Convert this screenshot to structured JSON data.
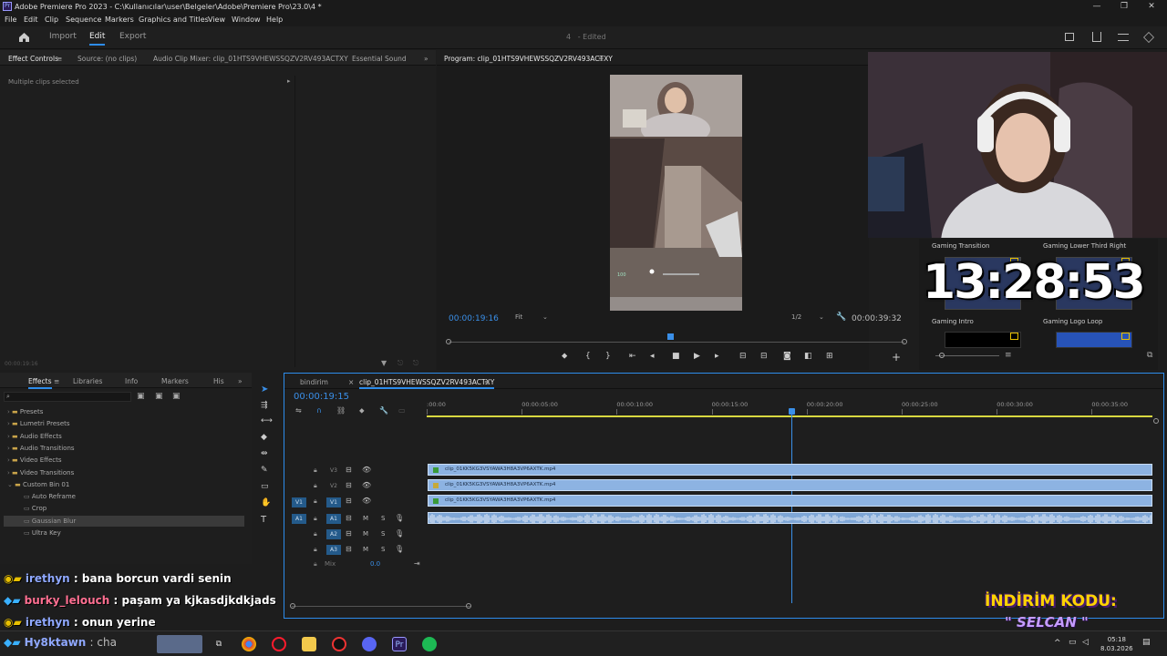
{
  "window": {
    "title": "Adobe Premiere Pro 2023 - C:\\Kullanıcılar\\user\\Belgeler\\Adobe\\Premiere Pro\\23.0\\4 *",
    "app_icon": "Pr"
  },
  "menu": [
    "File",
    "Edit",
    "Clip",
    "Sequence",
    "Markers",
    "Graphics and Titles",
    "View",
    "Window",
    "Help"
  ],
  "workspace": {
    "tabs": [
      "Import",
      "Edit",
      "Export"
    ],
    "active_tab": "Edit",
    "project": "4",
    "project_status": "- Edited"
  },
  "source_panel": {
    "tabs": [
      "Effect Controls",
      "Source: (no clips)",
      "Audio Clip Mixer: clip_01HTS9VHEWSSQZV2RV493ACTXY",
      "Essential Sound"
    ],
    "message": "Multiple clips selected",
    "timecode": "00:00:19:16"
  },
  "program_monitor": {
    "tab": "Program: clip_01HTS9VHEWSSQZV2RV493ACTXY",
    "timecode": "00:00:19:16",
    "fit": "Fit",
    "resolution": "1/2",
    "duration": "00:00:39:32",
    "playhead_fraction": 0.485,
    "hud_health": "100"
  },
  "graphics_panel": {
    "items": [
      "Gaming Transition",
      "Gaming Lower Third Right",
      "Gaming Intro",
      "Gaming Logo Loop"
    ]
  },
  "overlay": {
    "clock": "13:28:53",
    "promo_line1": "İNDİRİM KODU:",
    "promo_line2": "\" SELCAN \""
  },
  "effects_panel": {
    "tabs": [
      "Effects",
      "Libraries",
      "Info",
      "Markers",
      "His"
    ],
    "folders": [
      "Presets",
      "Lumetri Presets",
      "Audio Effects",
      "Audio Transitions",
      "Video Effects",
      "Video Transitions",
      "Custom Bin 01"
    ],
    "bin_items": [
      "Auto Reframe",
      "Crop",
      "Gaussian Blur",
      "Ultra Key"
    ],
    "selected_item": "Gaussian Blur"
  },
  "timeline": {
    "tabs": [
      "bindirim",
      "clip_01HTS9VHEWSSQZV2RV493ACTXY"
    ],
    "active_tab": "clip_01HTS9VHEWSSQZV2RV493ACTXY",
    "timecode": "00:00:19:15",
    "ruler": [
      ":00:00",
      "00:00:05:00",
      "00:00:10:00",
      "00:00:15:00",
      "00:00:20:00",
      "00:00:25:00",
      "00:00:30:00",
      "00:00:35:00"
    ],
    "playhead_fraction": 0.503,
    "video_tracks": [
      "V3",
      "V2",
      "V1"
    ],
    "audio_tracks": [
      "A1",
      "A2",
      "A3"
    ],
    "source_patch_video": "V1",
    "source_patch_audio": "A1",
    "mute_label": "M",
    "solo_label": "S",
    "mix_label": "Mix",
    "mix_value": "0.0",
    "clips": [
      {
        "track": "V3",
        "name": "clip_01KK5KG3VSYAWA3H8A3VP6AXTK.mp4"
      },
      {
        "track": "V2",
        "name": "clip_01KK5KG3VSYAWA3H8A3VP6AXTK.mp4"
      },
      {
        "track": "V1",
        "name": "clip_01KK5KG3VSYAWA3H8A3VP6AXTK.mp4"
      }
    ]
  },
  "chat": [
    {
      "user": "irethyn",
      "message": ": bana borcun vardi senin"
    },
    {
      "user": "burky_lelouch",
      "message": ": paşam ya kjkasdjkdkjads"
    },
    {
      "user": "irethyn",
      "message": ": onun yerine"
    },
    {
      "user": "Hy8ktawn",
      "message": ": cha"
    }
  ],
  "taskbar": {
    "time": "05:18",
    "date": "8.03.2026",
    "apps": [
      "task-view",
      "chrome",
      "opera",
      "files",
      "app-red",
      "discord",
      "premiere",
      "spotify"
    ]
  },
  "colors": {
    "accent": "#2d8ceb",
    "clip_video": "#8db3e2",
    "clip_audio": "#7ea6d6",
    "ruler_workarea": "#d8d840",
    "promo": "#ffd400",
    "chat_name_1": "#8fa8ff",
    "chat_name_2": "#ff6f91"
  }
}
